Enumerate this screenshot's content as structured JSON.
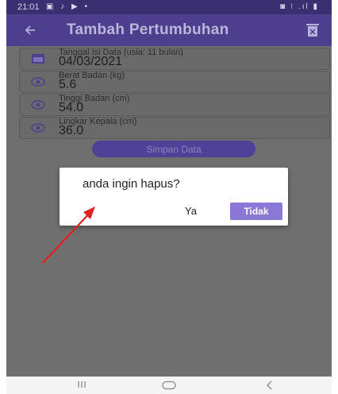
{
  "status_bar": {
    "time": "21:01"
  },
  "app_bar": {
    "title": "Tambah Pertumbuhan"
  },
  "form": {
    "fields": [
      {
        "label": "Tanggal Isi Data (usia: 11 bulan)",
        "value": "04/03/2021",
        "icon": "calendar-icon"
      },
      {
        "label": "Berat Badan (kg)",
        "value": "5.6",
        "icon": "eye-icon"
      },
      {
        "label": "Tinggi Badan (cm)",
        "value": "54.0",
        "icon": "eye-icon"
      },
      {
        "label": "Lingkar Kepala (cm)",
        "value": "36.0",
        "icon": "eye-icon"
      }
    ],
    "save_label": "Simpan Data"
  },
  "dialog": {
    "message": "anda ingin hapus?",
    "yes_label": "Ya",
    "no_label": "Tidak"
  },
  "colors": {
    "status_bar": "#3a2f70",
    "app_bar": "#4d3f8d",
    "accent": "#8a77d6",
    "annotation_arrow": "#e0221e"
  }
}
